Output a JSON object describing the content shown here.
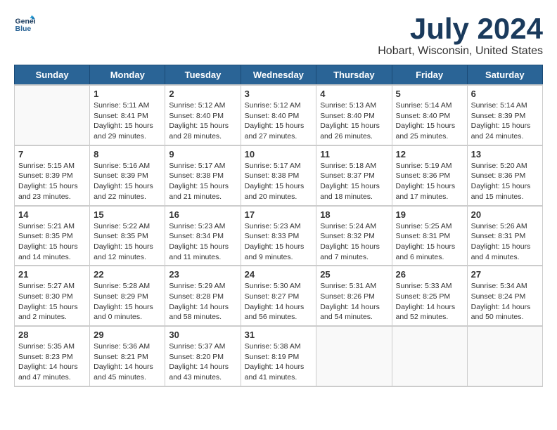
{
  "header": {
    "logo_line1": "General",
    "logo_line2": "Blue",
    "title": "July 2024",
    "subtitle": "Hobart, Wisconsin, United States"
  },
  "days_of_week": [
    "Sunday",
    "Monday",
    "Tuesday",
    "Wednesday",
    "Thursday",
    "Friday",
    "Saturday"
  ],
  "weeks": [
    [
      {
        "day": "",
        "info": ""
      },
      {
        "day": "1",
        "info": "Sunrise: 5:11 AM\nSunset: 8:41 PM\nDaylight: 15 hours\nand 29 minutes."
      },
      {
        "day": "2",
        "info": "Sunrise: 5:12 AM\nSunset: 8:40 PM\nDaylight: 15 hours\nand 28 minutes."
      },
      {
        "day": "3",
        "info": "Sunrise: 5:12 AM\nSunset: 8:40 PM\nDaylight: 15 hours\nand 27 minutes."
      },
      {
        "day": "4",
        "info": "Sunrise: 5:13 AM\nSunset: 8:40 PM\nDaylight: 15 hours\nand 26 minutes."
      },
      {
        "day": "5",
        "info": "Sunrise: 5:14 AM\nSunset: 8:40 PM\nDaylight: 15 hours\nand 25 minutes."
      },
      {
        "day": "6",
        "info": "Sunrise: 5:14 AM\nSunset: 8:39 PM\nDaylight: 15 hours\nand 24 minutes."
      }
    ],
    [
      {
        "day": "7",
        "info": "Sunrise: 5:15 AM\nSunset: 8:39 PM\nDaylight: 15 hours\nand 23 minutes."
      },
      {
        "day": "8",
        "info": "Sunrise: 5:16 AM\nSunset: 8:39 PM\nDaylight: 15 hours\nand 22 minutes."
      },
      {
        "day": "9",
        "info": "Sunrise: 5:17 AM\nSunset: 8:38 PM\nDaylight: 15 hours\nand 21 minutes."
      },
      {
        "day": "10",
        "info": "Sunrise: 5:17 AM\nSunset: 8:38 PM\nDaylight: 15 hours\nand 20 minutes."
      },
      {
        "day": "11",
        "info": "Sunrise: 5:18 AM\nSunset: 8:37 PM\nDaylight: 15 hours\nand 18 minutes."
      },
      {
        "day": "12",
        "info": "Sunrise: 5:19 AM\nSunset: 8:36 PM\nDaylight: 15 hours\nand 17 minutes."
      },
      {
        "day": "13",
        "info": "Sunrise: 5:20 AM\nSunset: 8:36 PM\nDaylight: 15 hours\nand 15 minutes."
      }
    ],
    [
      {
        "day": "14",
        "info": "Sunrise: 5:21 AM\nSunset: 8:35 PM\nDaylight: 15 hours\nand 14 minutes."
      },
      {
        "day": "15",
        "info": "Sunrise: 5:22 AM\nSunset: 8:35 PM\nDaylight: 15 hours\nand 12 minutes."
      },
      {
        "day": "16",
        "info": "Sunrise: 5:23 AM\nSunset: 8:34 PM\nDaylight: 15 hours\nand 11 minutes."
      },
      {
        "day": "17",
        "info": "Sunrise: 5:23 AM\nSunset: 8:33 PM\nDaylight: 15 hours\nand 9 minutes."
      },
      {
        "day": "18",
        "info": "Sunrise: 5:24 AM\nSunset: 8:32 PM\nDaylight: 15 hours\nand 7 minutes."
      },
      {
        "day": "19",
        "info": "Sunrise: 5:25 AM\nSunset: 8:31 PM\nDaylight: 15 hours\nand 6 minutes."
      },
      {
        "day": "20",
        "info": "Sunrise: 5:26 AM\nSunset: 8:31 PM\nDaylight: 15 hours\nand 4 minutes."
      }
    ],
    [
      {
        "day": "21",
        "info": "Sunrise: 5:27 AM\nSunset: 8:30 PM\nDaylight: 15 hours\nand 2 minutes."
      },
      {
        "day": "22",
        "info": "Sunrise: 5:28 AM\nSunset: 8:29 PM\nDaylight: 15 hours\nand 0 minutes."
      },
      {
        "day": "23",
        "info": "Sunrise: 5:29 AM\nSunset: 8:28 PM\nDaylight: 14 hours\nand 58 minutes."
      },
      {
        "day": "24",
        "info": "Sunrise: 5:30 AM\nSunset: 8:27 PM\nDaylight: 14 hours\nand 56 minutes."
      },
      {
        "day": "25",
        "info": "Sunrise: 5:31 AM\nSunset: 8:26 PM\nDaylight: 14 hours\nand 54 minutes."
      },
      {
        "day": "26",
        "info": "Sunrise: 5:33 AM\nSunset: 8:25 PM\nDaylight: 14 hours\nand 52 minutes."
      },
      {
        "day": "27",
        "info": "Sunrise: 5:34 AM\nSunset: 8:24 PM\nDaylight: 14 hours\nand 50 minutes."
      }
    ],
    [
      {
        "day": "28",
        "info": "Sunrise: 5:35 AM\nSunset: 8:23 PM\nDaylight: 14 hours\nand 47 minutes."
      },
      {
        "day": "29",
        "info": "Sunrise: 5:36 AM\nSunset: 8:21 PM\nDaylight: 14 hours\nand 45 minutes."
      },
      {
        "day": "30",
        "info": "Sunrise: 5:37 AM\nSunset: 8:20 PM\nDaylight: 14 hours\nand 43 minutes."
      },
      {
        "day": "31",
        "info": "Sunrise: 5:38 AM\nSunset: 8:19 PM\nDaylight: 14 hours\nand 41 minutes."
      },
      {
        "day": "",
        "info": ""
      },
      {
        "day": "",
        "info": ""
      },
      {
        "day": "",
        "info": ""
      }
    ]
  ]
}
